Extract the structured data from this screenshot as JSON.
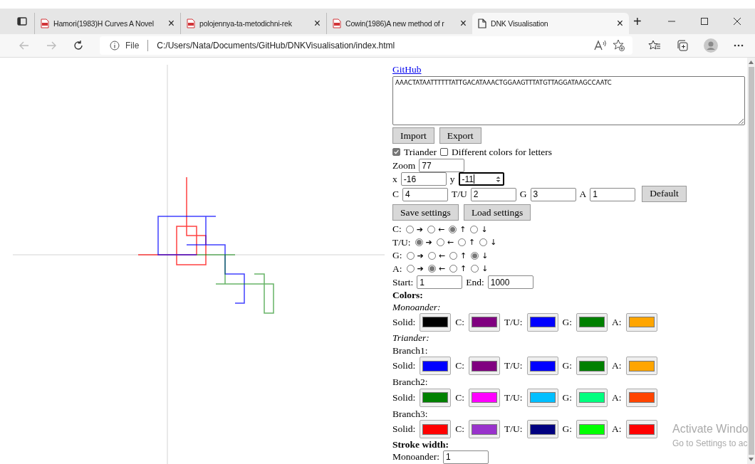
{
  "browser": {
    "tabs": [
      {
        "title": "Hamori(1983)H Curves A Novel",
        "kind": "pdf",
        "selected": false,
        "close": "×"
      },
      {
        "title": "polojennya-ta-metodichni-rek",
        "kind": "pdf",
        "selected": false,
        "close": "×"
      },
      {
        "title": "Cowin(1986)A new method of r",
        "kind": "pdf",
        "selected": false,
        "close": "×"
      },
      {
        "title": "DNK Visualisation",
        "kind": "page",
        "selected": true,
        "close": "×"
      }
    ],
    "new_tab": "+",
    "address_prefix": "File",
    "address": "C:/Users/Nata/Documents/GitHub/DNKVisualisation/index.html"
  },
  "panel": {
    "github_link": "GitHub",
    "sequence": "AAACTATAATTTTTTATTGACATAAACTGGAAGTTTATGTTAGGATAAGCCAATC",
    "file_buttons": [
      "Import",
      "Export"
    ],
    "checkboxes": [
      {
        "label": "Triander",
        "checked": true
      },
      {
        "label": "Different colors for letters",
        "checked": false
      }
    ],
    "zoom": {
      "label": "Zoom",
      "value": "77"
    },
    "position": [
      {
        "label": "x",
        "value": "-16",
        "focused": false
      },
      {
        "label": "y",
        "value": "-11",
        "focused": true
      }
    ],
    "weights": [
      {
        "label": "C",
        "value": "4"
      },
      {
        "label": "T/U",
        "value": "2"
      },
      {
        "label": "G",
        "value": "3"
      },
      {
        "label": "A",
        "value": "1"
      }
    ],
    "default_button": "Default",
    "settings_buttons": [
      "Save settings",
      "Load settings"
    ],
    "directions": [
      {
        "label": "C:",
        "options": [
          {
            "arrow": "➔",
            "selected": false
          },
          {
            "arrow": "←",
            "selected": false
          },
          {
            "arrow": "↑",
            "selected": true
          },
          {
            "arrow": "↓",
            "selected": false
          }
        ]
      },
      {
        "label": "T/U:",
        "options": [
          {
            "arrow": "➔",
            "selected": true
          },
          {
            "arrow": "←",
            "selected": false
          },
          {
            "arrow": "↑",
            "selected": false
          },
          {
            "arrow": "↓",
            "selected": false
          }
        ]
      },
      {
        "label": "G:",
        "options": [
          {
            "arrow": "➔",
            "selected": false
          },
          {
            "arrow": "←",
            "selected": false
          },
          {
            "arrow": "↑",
            "selected": false
          },
          {
            "arrow": "↓",
            "selected": true
          }
        ]
      },
      {
        "label": "A:",
        "options": [
          {
            "arrow": "➔",
            "selected": false
          },
          {
            "arrow": "←",
            "selected": true
          },
          {
            "arrow": "↑",
            "selected": false
          },
          {
            "arrow": "↓",
            "selected": false
          }
        ]
      }
    ],
    "range": [
      {
        "label": "Start:",
        "value": "1"
      },
      {
        "label": "End:",
        "value": "1000"
      }
    ],
    "colors_heading": "Colors:",
    "monoander_heading": "Monoander:",
    "monoander_colors": [
      {
        "label": "Solid:",
        "color": "#000000"
      },
      {
        "label": "C:",
        "color": "#800080"
      },
      {
        "label": "T/U:",
        "color": "#0000ff"
      },
      {
        "label": "G:",
        "color": "#008000"
      },
      {
        "label": "A:",
        "color": "#ffa500"
      }
    ],
    "triander_heading": "Triander:",
    "branches": [
      {
        "label": "Branch1:",
        "colors": [
          {
            "label": "Solid:",
            "color": "#0000ff"
          },
          {
            "label": "C:",
            "color": "#800080"
          },
          {
            "label": "T/U:",
            "color": "#0000ff"
          },
          {
            "label": "G:",
            "color": "#008000"
          },
          {
            "label": "A:",
            "color": "#ffa500"
          }
        ]
      },
      {
        "label": "Branch2:",
        "colors": [
          {
            "label": "Solid:",
            "color": "#008000"
          },
          {
            "label": "C:",
            "color": "#ff00ff"
          },
          {
            "label": "T/U:",
            "color": "#00bfff"
          },
          {
            "label": "G:",
            "color": "#00ff7f"
          },
          {
            "label": "A:",
            "color": "#ff4500"
          }
        ]
      },
      {
        "label": "Branch3:",
        "colors": [
          {
            "label": "Solid:",
            "color": "#ff0000"
          },
          {
            "label": "C:",
            "color": "#9932cc"
          },
          {
            "label": "T/U:",
            "color": "#000080"
          },
          {
            "label": "G:",
            "color": "#00ff00"
          },
          {
            "label": "A:",
            "color": "#ff0000"
          }
        ]
      }
    ],
    "stroke_heading": "Stroke width:",
    "stroke": {
      "label": "Monoander:",
      "value": "1"
    }
  },
  "activation": {
    "title": "Activate Windo",
    "subtitle": "Go to Settings to ac"
  }
}
